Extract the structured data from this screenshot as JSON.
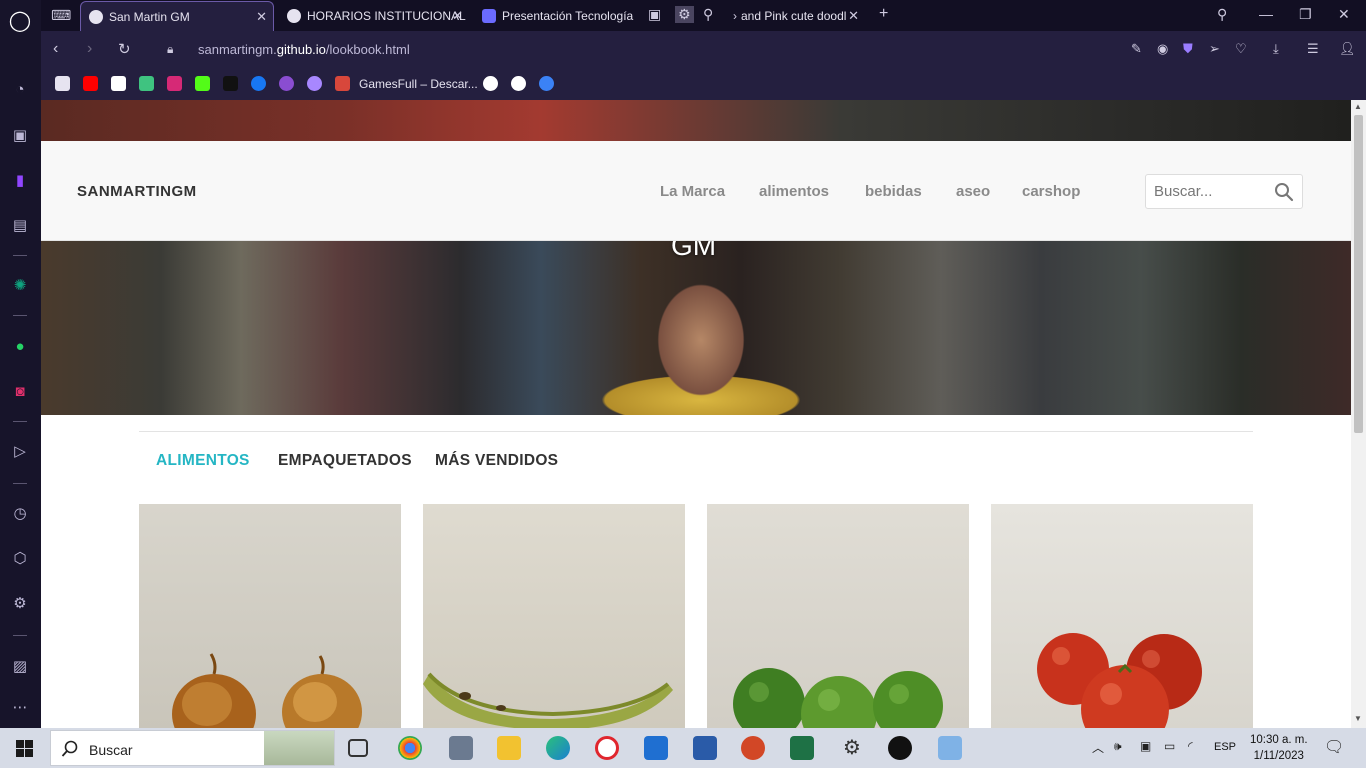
{
  "browser": {
    "tabs": [
      {
        "label": "San Martin GM",
        "active": true
      },
      {
        "label": "HORARIOS INSTITUCIONAL",
        "active": false
      },
      {
        "label": "Presentación Tecnología",
        "active": false
      },
      {
        "label": "and Pink cute doodl",
        "active": false
      }
    ],
    "url_prefix": "sanmartingm.",
    "url_domain": "github.io",
    "url_path": "/lookbook.html",
    "bookmark_label": "GamesFull – Descar..."
  },
  "site": {
    "brand": "SANMARTINGM",
    "nav": [
      "La Marca",
      "alimentos",
      "bebidas",
      "aseo",
      "carshop"
    ],
    "search_placeholder": "Buscar...",
    "hero_title": "GM",
    "categories": [
      "ALIMENTOS",
      "EMPAQUETADOS",
      "MÁS VENDIDOS"
    ],
    "accent_color": "#25b6c4",
    "products": [
      "onions",
      "banana",
      "limes",
      "tomatoes"
    ]
  },
  "taskbar": {
    "search_label": "Buscar",
    "language": "ESP",
    "time": "10:30 a. m.",
    "date": "1/11/2023"
  }
}
